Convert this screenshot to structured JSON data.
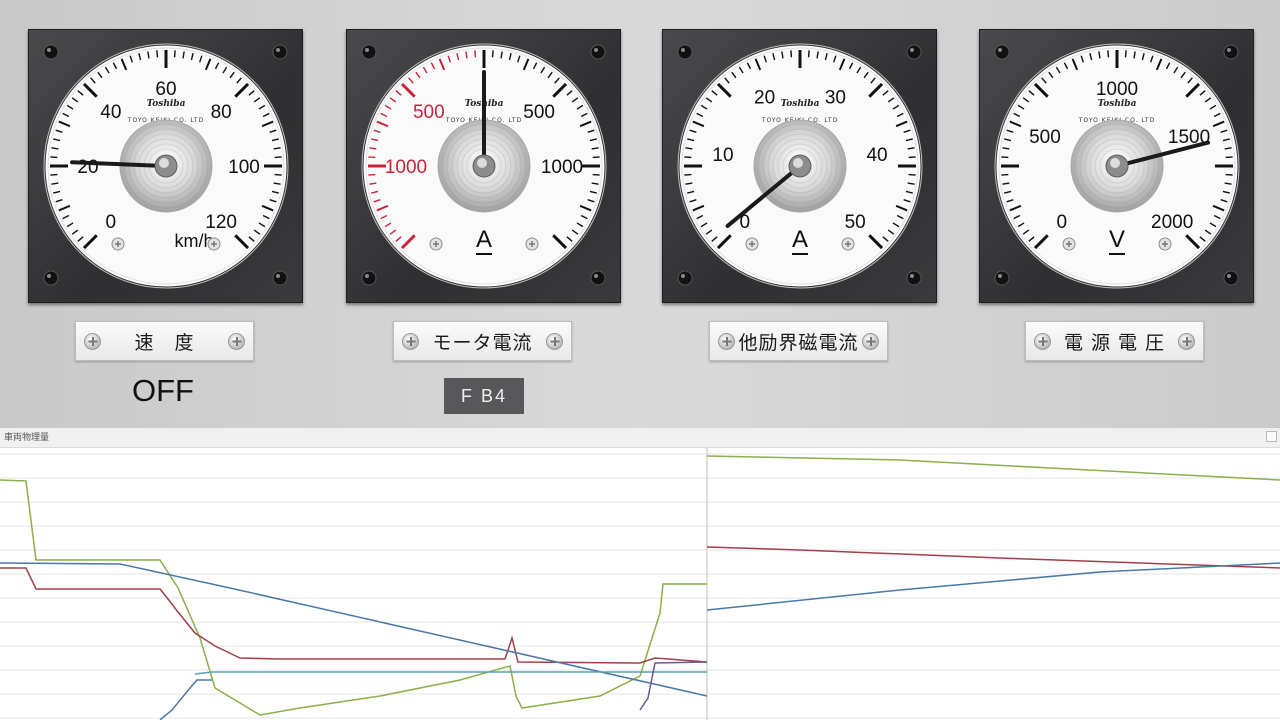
{
  "gauges": [
    {
      "id": "speed",
      "ticks": [
        "0",
        "20",
        "40",
        "60",
        "80",
        "100",
        "120"
      ],
      "unit": "km/h",
      "brand": "Toshiba",
      "maker": "TOYO KEIKI CO. LTD",
      "needle_value": 21,
      "range": [
        0,
        120
      ]
    },
    {
      "id": "motor-current",
      "ticks_left": [
        "1000",
        "500"
      ],
      "ticks_right": [
        "500",
        "1000"
      ],
      "unit": "A",
      "brand": "Toshiba",
      "maker": "TOYO KEIKI CO. LTD",
      "needle_value": 0,
      "range": [
        -1000,
        1000
      ]
    },
    {
      "id": "field-current",
      "ticks": [
        "0",
        "10",
        "20",
        "30",
        "40",
        "50"
      ],
      "unit": "A",
      "brand": "Toshiba",
      "maker": "TOYO KEIKI CO. LTD",
      "needle_value": 1,
      "range": [
        0,
        50
      ]
    },
    {
      "id": "line-voltage",
      "ticks": [
        "0",
        "500",
        "1000",
        "1500",
        "2000"
      ],
      "unit": "V",
      "brand": "Toshiba",
      "maker": "TOYO KEIKI CO. LTD",
      "needle_value": 1560,
      "range": [
        0,
        2000
      ]
    }
  ],
  "buttons": {
    "speed": "速　度",
    "motor_current": "モータ電流",
    "field_current": "他励界磁電流",
    "line_voltage": "電 源 電 圧"
  },
  "status": {
    "power": "OFF",
    "notch": "F  B4"
  },
  "graph": {
    "title": "車両物理量"
  },
  "colors": {
    "green": "#8ab04a",
    "red": "#a04048",
    "blue": "#4a78a8",
    "teal": "#5aa0a8",
    "purple": "#6a5a88",
    "red_scale": "#c8243c"
  }
}
